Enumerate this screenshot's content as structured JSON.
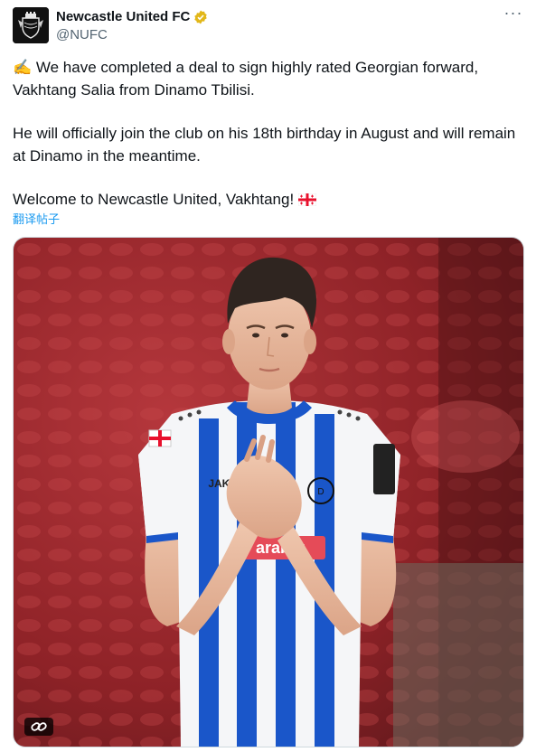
{
  "account": {
    "display_name": "Newcastle United FC",
    "handle": "@NUFC",
    "verified_icon": "gold-verified-badge-icon",
    "avatar_icon": "newcastle-crest-icon"
  },
  "tweet": {
    "paragraph_1_emoji": "✍️",
    "paragraph_1": " We have completed a deal to sign highly rated Georgian forward, Vakhtang Salia from Dinamo Tbilisi.",
    "paragraph_2": "He will officially join the club on his 18th birthday in August and will remain at Dinamo in the meantime.",
    "paragraph_3": "Welcome to Newcastle United, Vakhtang! ",
    "paragraph_3_flag_icon": "georgia-flag-icon",
    "translate_label": "翻译帖子"
  },
  "media": {
    "description_icon": "player-applauding-photo",
    "shirt_sponsor_text": "arabet",
    "shirt_maker_text": "JAKO",
    "link_icon": "link-icon"
  },
  "colors": {
    "accent": "#1d9bf0",
    "verified_gold": "#e2b719",
    "stripe_blue": "#1a56c9"
  },
  "more_icon": "more-dots-icon"
}
